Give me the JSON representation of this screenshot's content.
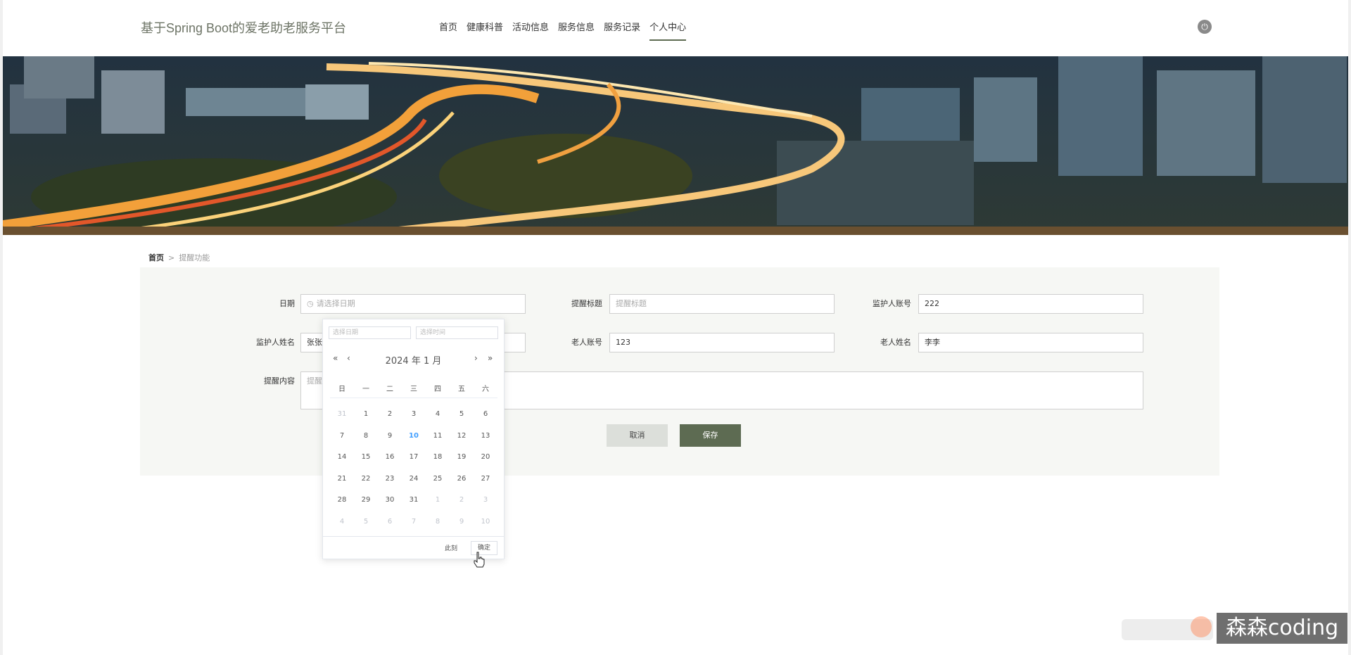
{
  "header": {
    "site_title": "基于Spring Boot的爱老助老服务平台",
    "nav": [
      "首页",
      "健康科普",
      "活动信息",
      "服务信息",
      "服务记录",
      "个人中心"
    ],
    "active_nav": "个人中心"
  },
  "breadcrumb": {
    "home": "首页",
    "separator": ">",
    "current": "提醒功能"
  },
  "form": {
    "date_label": "日期",
    "date_placeholder": "请选择日期",
    "title_label": "提醒标题",
    "title_placeholder": "提醒标题",
    "guardian_account_label": "监护人账号",
    "guardian_account_value": "222",
    "guardian_name_label": "监护人姓名",
    "guardian_name_value": "张张",
    "elder_account_label": "老人账号",
    "elder_account_value": "123",
    "elder_name_label": "老人姓名",
    "elder_name_value": "李李",
    "content_label": "提醒内容",
    "content_placeholder": "提醒内容",
    "cancel_label": "取消",
    "save_label": "保存"
  },
  "picker": {
    "date_input_placeholder": "选择日期",
    "time_input_placeholder": "选择时间",
    "prev_year": "«",
    "prev_month": "‹",
    "next_month": "›",
    "next_year": "»",
    "title": "2024 年  1 月",
    "weekdays": [
      "日",
      "一",
      "二",
      "三",
      "四",
      "五",
      "六"
    ],
    "days": [
      {
        "d": "31",
        "other": true
      },
      {
        "d": "1"
      },
      {
        "d": "2"
      },
      {
        "d": "3"
      },
      {
        "d": "4"
      },
      {
        "d": "5"
      },
      {
        "d": "6"
      },
      {
        "d": "7"
      },
      {
        "d": "8"
      },
      {
        "d": "9"
      },
      {
        "d": "10",
        "today": true
      },
      {
        "d": "11"
      },
      {
        "d": "12"
      },
      {
        "d": "13"
      },
      {
        "d": "14"
      },
      {
        "d": "15"
      },
      {
        "d": "16"
      },
      {
        "d": "17"
      },
      {
        "d": "18"
      },
      {
        "d": "19"
      },
      {
        "d": "20"
      },
      {
        "d": "21"
      },
      {
        "d": "22"
      },
      {
        "d": "23"
      },
      {
        "d": "24"
      },
      {
        "d": "25"
      },
      {
        "d": "26"
      },
      {
        "d": "27"
      },
      {
        "d": "28"
      },
      {
        "d": "29"
      },
      {
        "d": "30"
      },
      {
        "d": "31"
      },
      {
        "d": "1",
        "other": true
      },
      {
        "d": "2",
        "other": true
      },
      {
        "d": "3",
        "other": true
      },
      {
        "d": "4",
        "other": true
      },
      {
        "d": "5",
        "other": true
      },
      {
        "d": "6",
        "other": true
      },
      {
        "d": "7",
        "other": true
      },
      {
        "d": "8",
        "other": true
      },
      {
        "d": "9",
        "other": true
      },
      {
        "d": "10",
        "other": true
      }
    ],
    "now_label": "此刻",
    "confirm_label": "确定"
  },
  "watermark": "森森coding",
  "icons": {
    "power": "power-icon",
    "clock": "clock-icon"
  },
  "colors": {
    "accent": "#5d6b52",
    "today": "#409eff"
  }
}
